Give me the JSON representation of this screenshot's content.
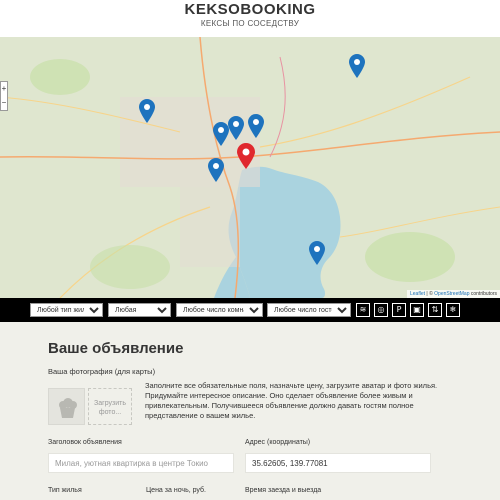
{
  "header": {
    "logo": "KEKSOBOOKING",
    "tagline": "КЕКСЫ ПО СОСЕДСТВУ"
  },
  "map": {
    "zoom_in": "+",
    "zoom_out": "−",
    "attribution_leaflet": "Leaflet",
    "attribution_sep": " | © ",
    "attribution_osm": "OpenStreetMap",
    "attribution_tail": " contributors",
    "water_color": "#aad3df",
    "land_color": "#dfe6cf",
    "pin_color": "#1e73be",
    "main_pin_color": "#e0282e"
  },
  "filters": {
    "type": "Любой тип жилья",
    "price": "Любая",
    "rooms": "Любое число комнат",
    "guests": "Любое число гостей",
    "features": [
      "wifi-icon",
      "dishwasher-icon",
      "parking-icon",
      "washer-icon",
      "elevator-icon",
      "conditioner-icon"
    ]
  },
  "form": {
    "title": "Ваше объявление",
    "avatar_label": "Ваша фотография (для карты)",
    "upload_label": "Загрузить фото...",
    "hint": "Заполните все обязательные поля, назначьте цену, загрузите аватар и фото жилья. Придумайте интересное описание. Оно сделает объявление более живым и привлекательным. Получившееся объявление должно давать гостям полное представление о вашем жилье.",
    "title_label": "Заголовок объявления",
    "title_placeholder": "Милая, уютная квартирка в центре Токио",
    "address_label": "Адрес (координаты)",
    "address_value": "35.62605, 139.77081",
    "type_label": "Тип жилья",
    "price_label": "Цена за ночь, руб.",
    "time_label": "Время заезда и выезда"
  }
}
